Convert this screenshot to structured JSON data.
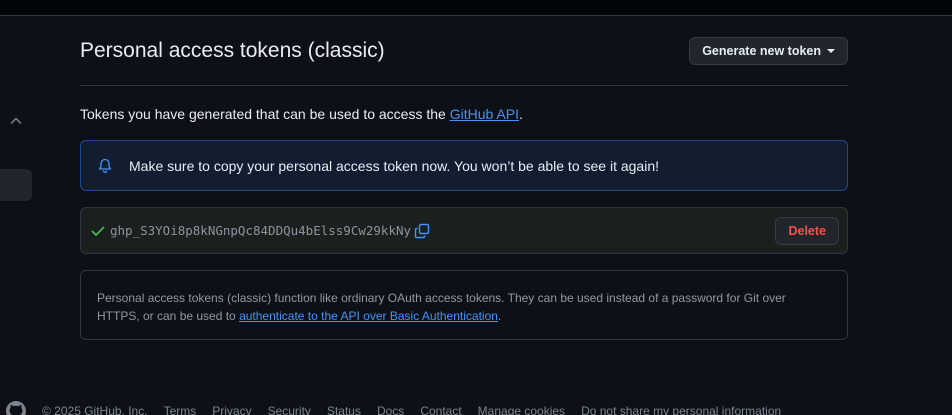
{
  "page": {
    "title": "Personal access tokens (classic)",
    "generate_button": "Generate new token",
    "description_prefix": "Tokens you have generated that can be used to access the ",
    "description_link": "GitHub API",
    "description_suffix": "."
  },
  "flash": {
    "message": "Make sure to copy your personal access token now. You won’t be able to see it again!",
    "icon": "bell-icon"
  },
  "token": {
    "value": "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",
    "delete_label": "Delete",
    "status_icon": "check-icon",
    "copy_icon": "copy-icon"
  },
  "info": {
    "text": "Personal access tokens (classic) function like ordinary OAuth access tokens. They can be used instead of a password for Git over HTTPS, or can be used to ",
    "link": "authenticate to the API over Basic Authentication",
    "suffix": "."
  },
  "footer": {
    "copyright": "© 2025 GitHub, Inc.",
    "links": [
      "Terms",
      "Privacy",
      "Security",
      "Status",
      "Docs",
      "Contact",
      "Manage cookies",
      "Do not share my personal information"
    ]
  },
  "colors": {
    "background": "#0d1117",
    "accent": "#4493f8",
    "danger": "#f85149",
    "success": "#3fb950"
  }
}
